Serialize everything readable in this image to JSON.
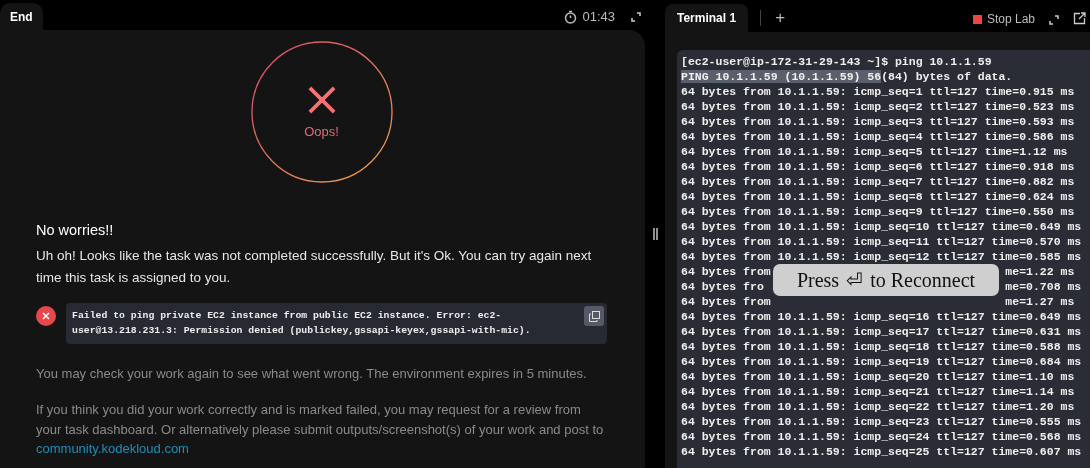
{
  "left_panel": {
    "tab": {
      "label": "End",
      "selected": true
    },
    "timer": "01:43",
    "result": {
      "label": "Oops!"
    },
    "heading": "No worries!!",
    "message": "Uh oh! Looks like the task was not completed successfully. But it's Ok. You can try again next time this task is assigned to you.",
    "error": {
      "text": "Failed to ping private EC2 instance from public EC2 instance. Error: ec2-user@13.218.231.3: Permission denied (publickey,gssapi-keyex,gssapi-with-mic)."
    },
    "note": "You may check your work again to see what went wrong. The environment expires in 5 minutes.",
    "review_text": "If you think you did your work correctly and is marked failed, you may request for a review from your task dashboard. Or alternatively please submit outputs/screenshot(s) of your work and post to",
    "link": "community.kodekloud.com"
  },
  "terminal": {
    "tabs": [
      {
        "label": "Terminal 1",
        "selected": true
      }
    ],
    "add_tab": "+",
    "stop_button": "Stop Lab",
    "lines": [
      {
        "kind": "text",
        "text": "[ec2-user@ip-172-31-29-143 ~]$ ping 10.1.1.59"
      },
      {
        "kind": "segments",
        "segments": [
          {
            "text": "PING 10.1.1.59 (10.1.1.59) 56",
            "selected": true
          },
          {
            "text": "(84) bytes of data.",
            "selected": false
          }
        ]
      },
      {
        "kind": "text",
        "text": "64 bytes from 10.1.1.59: icmp_seq=1 ttl=127 time=0.915 ms"
      },
      {
        "kind": "text",
        "text": "64 bytes from 10.1.1.59: icmp_seq=2 ttl=127 time=0.523 ms"
      },
      {
        "kind": "text",
        "text": "64 bytes from 10.1.1.59: icmp_seq=3 ttl=127 time=0.593 ms"
      },
      {
        "kind": "text",
        "text": "64 bytes from 10.1.1.59: icmp_seq=4 ttl=127 time=0.586 ms"
      },
      {
        "kind": "text",
        "text": "64 bytes from 10.1.1.59: icmp_seq=5 ttl=127 time=1.12 ms"
      },
      {
        "kind": "text",
        "text": "64 bytes from 10.1.1.59: icmp_seq=6 ttl=127 time=0.918 ms"
      },
      {
        "kind": "text",
        "text": "64 bytes from 10.1.1.59: icmp_seq=7 ttl=127 time=0.882 ms"
      },
      {
        "kind": "text",
        "text": "64 bytes from 10.1.1.59: icmp_seq=8 ttl=127 time=0.624 ms"
      },
      {
        "kind": "text",
        "text": "64 bytes from 10.1.1.59: icmp_seq=9 ttl=127 time=0.550 ms"
      },
      {
        "kind": "text",
        "text": "64 bytes from 10.1.1.59: icmp_seq=10 ttl=127 time=0.649 ms"
      },
      {
        "kind": "text",
        "text": "64 bytes from 10.1.1.59: icmp_seq=11 ttl=127 time=0.570 ms"
      },
      {
        "kind": "text",
        "text": "64 bytes from 10.1.1.59: icmp_seq=12 ttl=127 time=0.585 ms"
      },
      {
        "kind": "covered",
        "left": "64 bytes from",
        "right": "me=1.22 ms"
      },
      {
        "kind": "covered",
        "left": "64 bytes fro",
        "right": "me=0.708 ms"
      },
      {
        "kind": "covered",
        "left": "64 bytes from",
        "right": "me=1.27 ms"
      },
      {
        "kind": "text",
        "text": "64 bytes from 10.1.1.59: icmp_seq=16 ttl=127 time=0.649 ms"
      },
      {
        "kind": "text",
        "text": "64 bytes from 10.1.1.59: icmp_seq=17 ttl=127 time=0.631 ms"
      },
      {
        "kind": "text",
        "text": "64 bytes from 10.1.1.59: icmp_seq=18 ttl=127 time=0.588 ms"
      },
      {
        "kind": "text",
        "text": "64 bytes from 10.1.1.59: icmp_seq=19 ttl=127 time=0.684 ms"
      },
      {
        "kind": "text",
        "text": "64 bytes from 10.1.1.59: icmp_seq=20 ttl=127 time=1.10 ms"
      },
      {
        "kind": "text",
        "text": "64 bytes from 10.1.1.59: icmp_seq=21 ttl=127 time=1.14 ms"
      },
      {
        "kind": "text",
        "text": "64 bytes from 10.1.1.59: icmp_seq=22 ttl=127 time=1.20 ms"
      },
      {
        "kind": "text",
        "text": "64 bytes from 10.1.1.59: icmp_seq=23 ttl=127 time=0.555 ms"
      },
      {
        "kind": "text",
        "text": "64 bytes from 10.1.1.59: icmp_seq=24 ttl=127 time=0.568 ms"
      },
      {
        "kind": "text",
        "text": "64 bytes from 10.1.1.59: icmp_seq=25 ttl=127 time=0.607 ms"
      }
    ],
    "overlay": {
      "before": "Press",
      "key": "⏎",
      "after": "to Reconnect"
    }
  }
}
